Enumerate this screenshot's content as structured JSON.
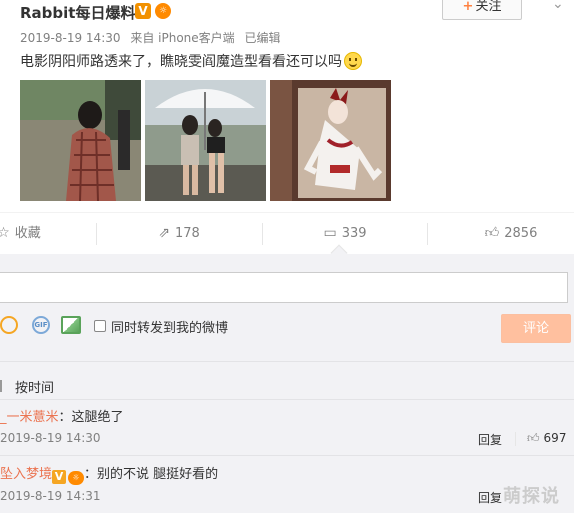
{
  "post": {
    "author": "Rabbit每日爆料",
    "timestamp": "2019-8-19 14:30",
    "source": "来自 iPhone客户端",
    "edited": "已编辑",
    "follow_label": "关注",
    "follow_plus": "+",
    "text": "电影阴阳师路透来了，瞧晓雯阎魔造型看看还可以吗",
    "images": [
      {
        "name": "photo-actress-plaid-dress"
      },
      {
        "name": "photo-actress-umbrella"
      },
      {
        "name": "photo-yama-character-art"
      }
    ]
  },
  "actions": {
    "collect_label": "收藏",
    "repost_count": "178",
    "comment_count": "339",
    "like_count": "2856"
  },
  "composer": {
    "input_value": "",
    "repost_option": "同时转发到我的微博",
    "submit_label": "评论",
    "gif_label": "GIF"
  },
  "comments_header": {
    "sort_label": "按时间"
  },
  "comments": [
    {
      "user": "_一米薏米",
      "text": "：这腿绝了",
      "time": "2019-8-19 14:30",
      "reply_label": "回复",
      "likes": "697"
    },
    {
      "user": "坠入梦境",
      "text": "：别的不说 腿挺好看的",
      "time": "2019-8-19 14:31",
      "reply_label": "回复",
      "likes": ""
    }
  ],
  "watermark": "萌探说",
  "colors": {
    "accent_orange": "#eb7350",
    "submit_disabled": "#ffc09f",
    "background_gray": "#f2f2f5"
  }
}
